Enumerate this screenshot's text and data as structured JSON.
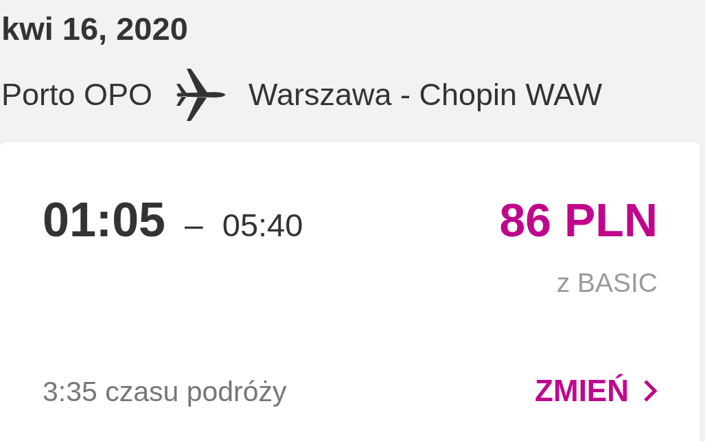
{
  "flight": {
    "date": "kwi 16, 2020",
    "origin": "Porto OPO",
    "destination": "Warszawa - Chopin WAW"
  },
  "fare_card": {
    "departure": "01:05",
    "separator": "–",
    "arrival": "05:40",
    "price": "86 PLN",
    "fare_class": "z BASIC",
    "duration": "3:35 czasu podróży",
    "change_button": {
      "label": "ZMIEŃ"
    }
  }
}
